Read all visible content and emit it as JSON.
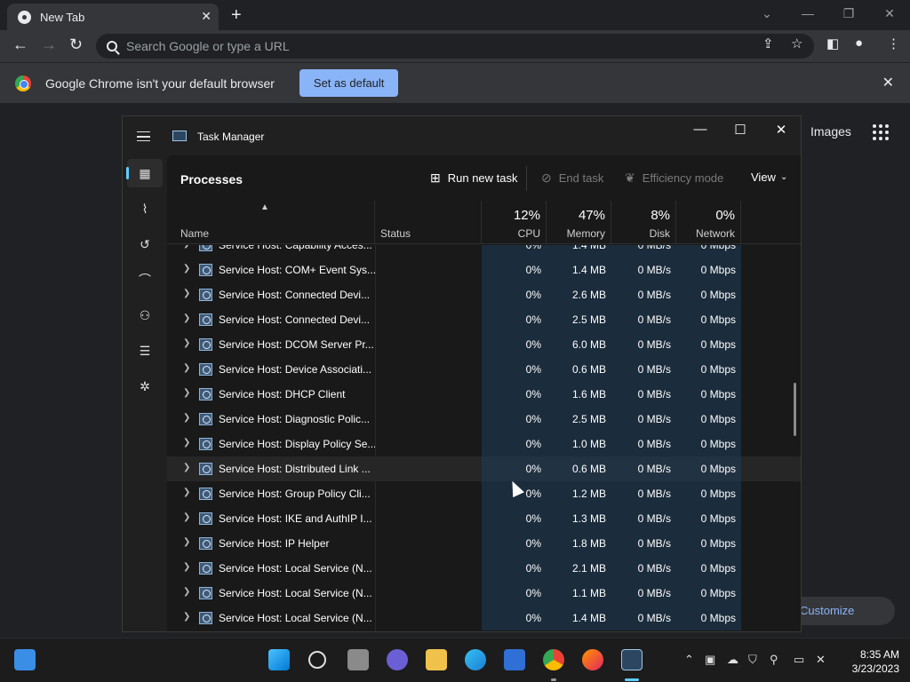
{
  "browser": {
    "tab_title": "New Tab",
    "omnibox_placeholder": "Search Google or type a URL",
    "infobar_message": "Google Chrome isn't your default browser",
    "set_default_label": "Set as default",
    "images_link": "Images",
    "customize_label": "Customize Chrome"
  },
  "taskmanager": {
    "title": "Task Manager",
    "page_title": "Processes",
    "commands": {
      "run_new_task": "Run new task",
      "end_task": "End task",
      "efficiency_mode": "Efficiency mode",
      "view": "View"
    },
    "columns": {
      "name": "Name",
      "status": "Status",
      "cpu_pct": "12%",
      "cpu": "CPU",
      "memory_pct": "47%",
      "memory": "Memory",
      "disk_pct": "8%",
      "disk": "Disk",
      "network_pct": "0%",
      "network": "Network"
    },
    "rows": [
      {
        "name": "Service Host: Capability Acces...",
        "cpu": "0%",
        "memory": "1.4 MB",
        "disk": "0 MB/s",
        "network": "0 Mbps"
      },
      {
        "name": "Service Host: COM+ Event Sys...",
        "cpu": "0%",
        "memory": "1.4 MB",
        "disk": "0 MB/s",
        "network": "0 Mbps"
      },
      {
        "name": "Service Host: Connected Devi...",
        "cpu": "0%",
        "memory": "2.6 MB",
        "disk": "0 MB/s",
        "network": "0 Mbps"
      },
      {
        "name": "Service Host: Connected Devi...",
        "cpu": "0%",
        "memory": "2.5 MB",
        "disk": "0 MB/s",
        "network": "0 Mbps"
      },
      {
        "name": "Service Host: DCOM Server Pr...",
        "cpu": "0%",
        "memory": "6.0 MB",
        "disk": "0 MB/s",
        "network": "0 Mbps"
      },
      {
        "name": "Service Host: Device Associati...",
        "cpu": "0%",
        "memory": "0.6 MB",
        "disk": "0 MB/s",
        "network": "0 Mbps"
      },
      {
        "name": "Service Host: DHCP Client",
        "cpu": "0%",
        "memory": "1.6 MB",
        "disk": "0 MB/s",
        "network": "0 Mbps"
      },
      {
        "name": "Service Host: Diagnostic Polic...",
        "cpu": "0%",
        "memory": "2.5 MB",
        "disk": "0 MB/s",
        "network": "0 Mbps"
      },
      {
        "name": "Service Host: Display Policy Se...",
        "cpu": "0%",
        "memory": "1.0 MB",
        "disk": "0 MB/s",
        "network": "0 Mbps"
      },
      {
        "name": "Service Host: Distributed Link ...",
        "cpu": "0%",
        "memory": "0.6 MB",
        "disk": "0 MB/s",
        "network": "0 Mbps"
      },
      {
        "name": "Service Host: Group Policy Cli...",
        "cpu": "0%",
        "memory": "1.2 MB",
        "disk": "0 MB/s",
        "network": "0 Mbps"
      },
      {
        "name": "Service Host: IKE and AuthIP I...",
        "cpu": "0%",
        "memory": "1.3 MB",
        "disk": "0 MB/s",
        "network": "0 Mbps"
      },
      {
        "name": "Service Host: IP Helper",
        "cpu": "0%",
        "memory": "1.8 MB",
        "disk": "0 MB/s",
        "network": "0 Mbps"
      },
      {
        "name": "Service Host: Local Service (N...",
        "cpu": "0%",
        "memory": "2.1 MB",
        "disk": "0 MB/s",
        "network": "0 Mbps"
      },
      {
        "name": "Service Host: Local Service (N...",
        "cpu": "0%",
        "memory": "1.1 MB",
        "disk": "0 MB/s",
        "network": "0 Mbps"
      },
      {
        "name": "Service Host: Local Service (N...",
        "cpu": "0%",
        "memory": "1.4 MB",
        "disk": "0 MB/s",
        "network": "0 Mbps"
      }
    ],
    "hover_row_index": 9
  },
  "taskbar": {
    "time": "8:35 AM",
    "date": "3/23/2023"
  },
  "colors": {
    "accent": "#60cdff",
    "chrome_button": "#8ab4f8",
    "column_highlight": "#1e3c5a"
  }
}
